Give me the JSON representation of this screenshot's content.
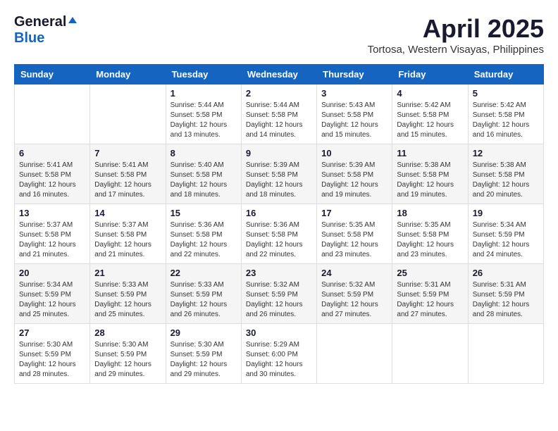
{
  "logo": {
    "general": "General",
    "blue": "Blue"
  },
  "title": {
    "month_year": "April 2025",
    "location": "Tortosa, Western Visayas, Philippines"
  },
  "headers": [
    "Sunday",
    "Monday",
    "Tuesday",
    "Wednesday",
    "Thursday",
    "Friday",
    "Saturday"
  ],
  "weeks": [
    [
      {
        "day": "",
        "info": ""
      },
      {
        "day": "",
        "info": ""
      },
      {
        "day": "1",
        "info": "Sunrise: 5:44 AM\nSunset: 5:58 PM\nDaylight: 12 hours and 13 minutes."
      },
      {
        "day": "2",
        "info": "Sunrise: 5:44 AM\nSunset: 5:58 PM\nDaylight: 12 hours and 14 minutes."
      },
      {
        "day": "3",
        "info": "Sunrise: 5:43 AM\nSunset: 5:58 PM\nDaylight: 12 hours and 15 minutes."
      },
      {
        "day": "4",
        "info": "Sunrise: 5:42 AM\nSunset: 5:58 PM\nDaylight: 12 hours and 15 minutes."
      },
      {
        "day": "5",
        "info": "Sunrise: 5:42 AM\nSunset: 5:58 PM\nDaylight: 12 hours and 16 minutes."
      }
    ],
    [
      {
        "day": "6",
        "info": "Sunrise: 5:41 AM\nSunset: 5:58 PM\nDaylight: 12 hours and 16 minutes."
      },
      {
        "day": "7",
        "info": "Sunrise: 5:41 AM\nSunset: 5:58 PM\nDaylight: 12 hours and 17 minutes."
      },
      {
        "day": "8",
        "info": "Sunrise: 5:40 AM\nSunset: 5:58 PM\nDaylight: 12 hours and 18 minutes."
      },
      {
        "day": "9",
        "info": "Sunrise: 5:39 AM\nSunset: 5:58 PM\nDaylight: 12 hours and 18 minutes."
      },
      {
        "day": "10",
        "info": "Sunrise: 5:39 AM\nSunset: 5:58 PM\nDaylight: 12 hours and 19 minutes."
      },
      {
        "day": "11",
        "info": "Sunrise: 5:38 AM\nSunset: 5:58 PM\nDaylight: 12 hours and 19 minutes."
      },
      {
        "day": "12",
        "info": "Sunrise: 5:38 AM\nSunset: 5:58 PM\nDaylight: 12 hours and 20 minutes."
      }
    ],
    [
      {
        "day": "13",
        "info": "Sunrise: 5:37 AM\nSunset: 5:58 PM\nDaylight: 12 hours and 21 minutes."
      },
      {
        "day": "14",
        "info": "Sunrise: 5:37 AM\nSunset: 5:58 PM\nDaylight: 12 hours and 21 minutes."
      },
      {
        "day": "15",
        "info": "Sunrise: 5:36 AM\nSunset: 5:58 PM\nDaylight: 12 hours and 22 minutes."
      },
      {
        "day": "16",
        "info": "Sunrise: 5:36 AM\nSunset: 5:58 PM\nDaylight: 12 hours and 22 minutes."
      },
      {
        "day": "17",
        "info": "Sunrise: 5:35 AM\nSunset: 5:58 PM\nDaylight: 12 hours and 23 minutes."
      },
      {
        "day": "18",
        "info": "Sunrise: 5:35 AM\nSunset: 5:58 PM\nDaylight: 12 hours and 23 minutes."
      },
      {
        "day": "19",
        "info": "Sunrise: 5:34 AM\nSunset: 5:59 PM\nDaylight: 12 hours and 24 minutes."
      }
    ],
    [
      {
        "day": "20",
        "info": "Sunrise: 5:34 AM\nSunset: 5:59 PM\nDaylight: 12 hours and 25 minutes."
      },
      {
        "day": "21",
        "info": "Sunrise: 5:33 AM\nSunset: 5:59 PM\nDaylight: 12 hours and 25 minutes."
      },
      {
        "day": "22",
        "info": "Sunrise: 5:33 AM\nSunset: 5:59 PM\nDaylight: 12 hours and 26 minutes."
      },
      {
        "day": "23",
        "info": "Sunrise: 5:32 AM\nSunset: 5:59 PM\nDaylight: 12 hours and 26 minutes."
      },
      {
        "day": "24",
        "info": "Sunrise: 5:32 AM\nSunset: 5:59 PM\nDaylight: 12 hours and 27 minutes."
      },
      {
        "day": "25",
        "info": "Sunrise: 5:31 AM\nSunset: 5:59 PM\nDaylight: 12 hours and 27 minutes."
      },
      {
        "day": "26",
        "info": "Sunrise: 5:31 AM\nSunset: 5:59 PM\nDaylight: 12 hours and 28 minutes."
      }
    ],
    [
      {
        "day": "27",
        "info": "Sunrise: 5:30 AM\nSunset: 5:59 PM\nDaylight: 12 hours and 28 minutes."
      },
      {
        "day": "28",
        "info": "Sunrise: 5:30 AM\nSunset: 5:59 PM\nDaylight: 12 hours and 29 minutes."
      },
      {
        "day": "29",
        "info": "Sunrise: 5:30 AM\nSunset: 5:59 PM\nDaylight: 12 hours and 29 minutes."
      },
      {
        "day": "30",
        "info": "Sunrise: 5:29 AM\nSunset: 6:00 PM\nDaylight: 12 hours and 30 minutes."
      },
      {
        "day": "",
        "info": ""
      },
      {
        "day": "",
        "info": ""
      },
      {
        "day": "",
        "info": ""
      }
    ]
  ]
}
